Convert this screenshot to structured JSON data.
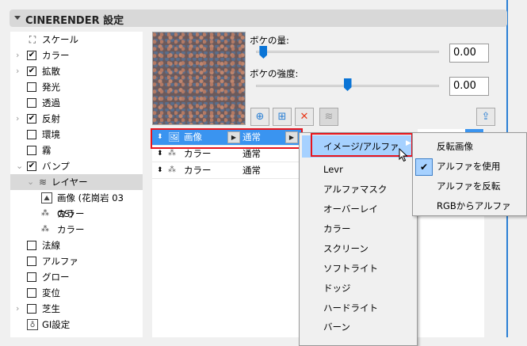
{
  "header": {
    "title": "CINERENDER 設定"
  },
  "tree": [
    {
      "label": "スケール",
      "icon": "scale-icon"
    },
    {
      "label": "カラー",
      "checked": true,
      "expandable": true
    },
    {
      "label": "拡散",
      "checked": true,
      "expandable": true
    },
    {
      "label": "発光",
      "checked": false
    },
    {
      "label": "透過",
      "checked": false
    },
    {
      "label": "反射",
      "checked": true,
      "expandable": true
    },
    {
      "label": "環境",
      "checked": false
    },
    {
      "label": "霧",
      "checked": false
    },
    {
      "label": "バンプ",
      "checked": true,
      "expanded": true
    },
    {
      "label": "レイヤー",
      "icon": "layers-icon",
      "selected": true
    },
    {
      "label": "画像 (花崗岩 03 GS)",
      "icon": "image-icon"
    },
    {
      "label": "カラー",
      "icon": "color-icon"
    },
    {
      "label": "カラー",
      "icon": "color-icon"
    },
    {
      "label": "法線",
      "checked": false
    },
    {
      "label": "アルファ",
      "checked": false
    },
    {
      "label": "グロー",
      "checked": false
    },
    {
      "label": "変位",
      "checked": false
    },
    {
      "label": "芝生",
      "checked": false,
      "expandable": true
    },
    {
      "label": "GI設定",
      "icon": "gi-icon"
    }
  ],
  "bokeh_amount": {
    "label": "ボケの量:",
    "value": "0.00",
    "slider_fraction": 0.02
  },
  "bokeh_strength": {
    "label": "ボケの強度:",
    "value": "0.00",
    "slider_fraction": 0.5
  },
  "layers": [
    {
      "name": "画像",
      "mode": "通常",
      "selected": true
    },
    {
      "name": "カラー",
      "mode": "通常"
    },
    {
      "name": "カラー",
      "mode": "通常"
    }
  ],
  "menu": {
    "items": [
      "イメージ/アルファ",
      "Levr",
      "アルファマスク",
      "オーバーレイ",
      "カラー",
      "スクリーン",
      "ソフトライト",
      "ドッジ",
      "ハードライト",
      "バーン"
    ]
  },
  "submenu": {
    "items": [
      "反転画像",
      "アルファを使用",
      "アルファを反転",
      "RGBからアルファ"
    ],
    "checked_index": 1
  },
  "check_mark": "✔"
}
